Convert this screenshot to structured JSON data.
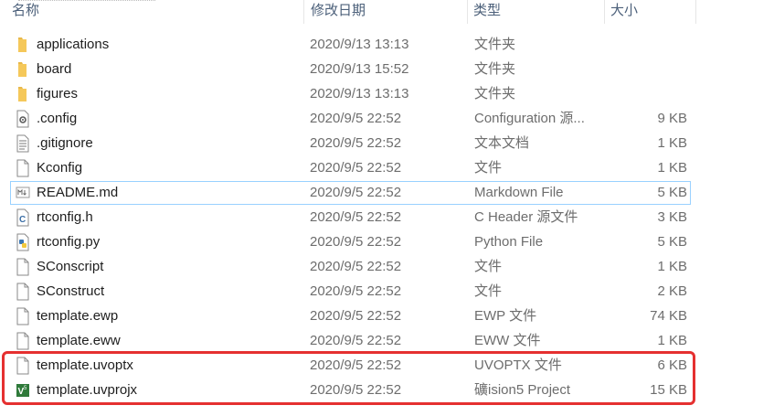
{
  "columns": {
    "name": "名称",
    "date": "修改日期",
    "type": "类型",
    "size": "大小"
  },
  "files": [
    {
      "icon": "folder-icon",
      "name": "applications",
      "date": "2020/9/13 13:13",
      "type": "文件夹",
      "size": ""
    },
    {
      "icon": "folder-icon",
      "name": "board",
      "date": "2020/9/13 15:52",
      "type": "文件夹",
      "size": ""
    },
    {
      "icon": "folder-icon",
      "name": "figures",
      "date": "2020/9/13 13:13",
      "type": "文件夹",
      "size": ""
    },
    {
      "icon": "config-file-icon",
      "name": ".config",
      "date": "2020/9/5 22:52",
      "type": "Configuration 源...",
      "size": "9 KB"
    },
    {
      "icon": "text-file-icon",
      "name": ".gitignore",
      "date": "2020/9/5 22:52",
      "type": "文本文档",
      "size": "1 KB"
    },
    {
      "icon": "blank-file-icon",
      "name": "Kconfig",
      "date": "2020/9/5 22:52",
      "type": "文件",
      "size": "1 KB"
    },
    {
      "icon": "markdown-file-icon",
      "name": "README.md",
      "date": "2020/9/5 22:52",
      "type": "Markdown File",
      "size": "5 KB"
    },
    {
      "icon": "c-header-file-icon",
      "name": "rtconfig.h",
      "date": "2020/9/5 22:52",
      "type": "C Header 源文件",
      "size": "3 KB"
    },
    {
      "icon": "python-file-icon",
      "name": "rtconfig.py",
      "date": "2020/9/5 22:52",
      "type": "Python File",
      "size": "5 KB"
    },
    {
      "icon": "blank-file-icon",
      "name": "SConscript",
      "date": "2020/9/5 22:52",
      "type": "文件",
      "size": "1 KB"
    },
    {
      "icon": "blank-file-icon",
      "name": "SConstruct",
      "date": "2020/9/5 22:52",
      "type": "文件",
      "size": "2 KB"
    },
    {
      "icon": "blank-file-icon",
      "name": "template.ewp",
      "date": "2020/9/5 22:52",
      "type": "EWP 文件",
      "size": "74 KB"
    },
    {
      "icon": "blank-file-icon",
      "name": "template.eww",
      "date": "2020/9/5 22:52",
      "type": "EWW 文件",
      "size": "1 KB"
    },
    {
      "icon": "blank-file-icon",
      "name": "template.uvoptx",
      "date": "2020/9/5 22:52",
      "type": "UVOPTX 文件",
      "size": "6 KB"
    },
    {
      "icon": "keil-uvision-icon",
      "name": "template.uvprojx",
      "date": "2020/9/5 22:52",
      "type": "礦ision5 Project",
      "size": "15 KB"
    }
  ],
  "colors": {
    "folder": "#e8b84a",
    "selection_border": "#99d1ff",
    "highlight": "#e53030",
    "header_text": "#4c607a"
  }
}
